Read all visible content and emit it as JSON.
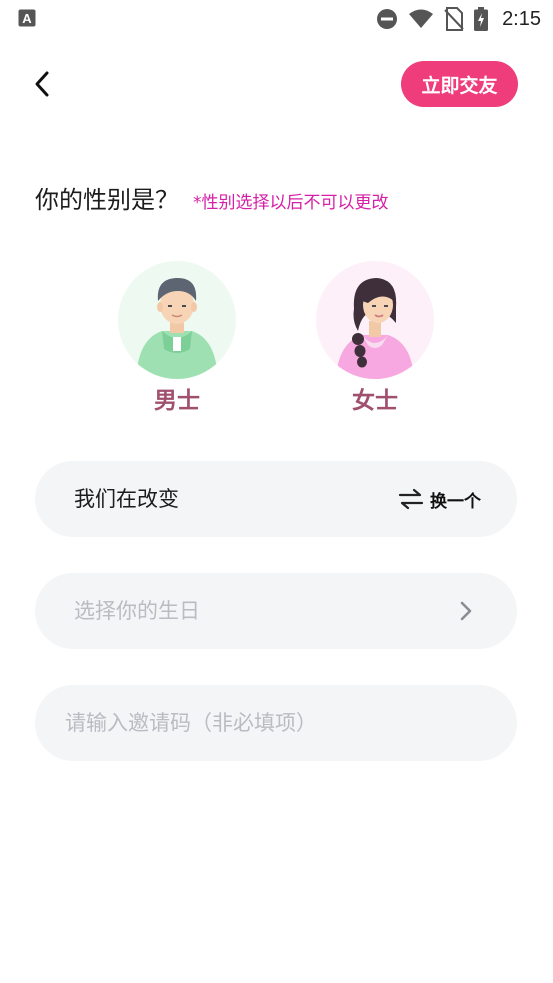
{
  "status_bar": {
    "time": "2:15",
    "app_icon": "a-app-icon",
    "icons": [
      "dnd-icon",
      "wifi-icon",
      "no-sim-icon",
      "battery-charging-icon"
    ]
  },
  "header": {
    "back_icon": "back-arrow-icon",
    "action_label": "立即交友"
  },
  "gender": {
    "question": "你的性别是？",
    "note": "*性别选择以后不可以更改",
    "options": [
      {
        "label": "男士",
        "icon": "male-avatar-icon"
      },
      {
        "label": "女士",
        "icon": "female-avatar-icon"
      }
    ]
  },
  "nickname": {
    "value": "我们在改变",
    "swap_label": "换一个",
    "swap_icon": "swap-arrows-icon"
  },
  "birthday": {
    "placeholder": "选择你的生日",
    "icon": "chevron-right-icon"
  },
  "invite": {
    "placeholder": "请输入邀请码（非必填项）",
    "value": ""
  },
  "colors": {
    "accent_button": "#ee3d7a",
    "note_text": "#d61fa6",
    "gender_label": "#a0506e",
    "field_bg": "#f4f5f7",
    "placeholder": "#b9bcc2",
    "male_circle": "#eefaf1",
    "female_circle": "#fdf0f8"
  }
}
